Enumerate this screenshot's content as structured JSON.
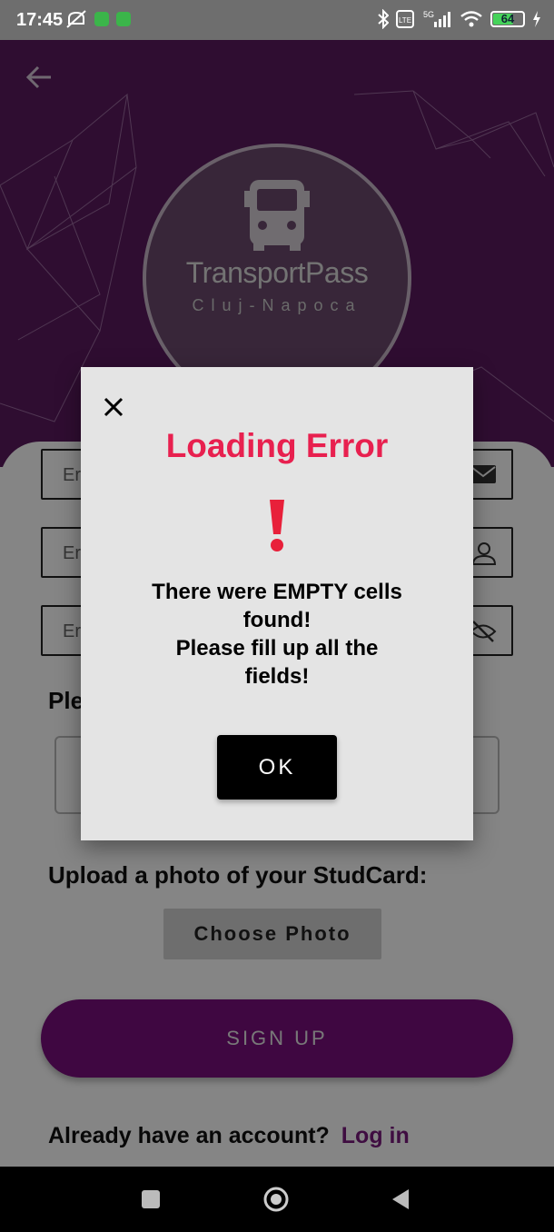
{
  "status_bar": {
    "time": "17:45",
    "battery_level": "64",
    "icons": [
      "mute-icon",
      "app-icon",
      "app-icon",
      "bluetooth-icon",
      "volte-icon",
      "5g-signal-icon",
      "wifi-icon",
      "battery-icon",
      "charging-icon"
    ]
  },
  "header": {
    "back_icon": "arrow-left-icon",
    "logo_title": "TransportPass",
    "logo_subtitle": "Cluj-Napoca"
  },
  "form": {
    "fields": [
      {
        "placeholder": "Er",
        "icon": "email-icon"
      },
      {
        "placeholder": "Er",
        "icon": "person-icon"
      },
      {
        "placeholder": "Er",
        "icon": "eye-off-icon"
      }
    ],
    "select_label": "Ple",
    "upload_label": "Upload a photo of your StudCard:",
    "choose_photo": "Choose Photo",
    "signup": "SIGN UP",
    "login_prompt": "Already have an account?",
    "login_link": "Log in"
  },
  "dialog": {
    "title": "Loading Error",
    "icon": "exclamation-icon",
    "message_line1": "There were EMPTY cells\nfound!",
    "message_line2": "Please fill up all the\nfields!",
    "ok": "OK",
    "close_icon": "close-icon",
    "title_color": "#e8204f"
  },
  "nav_bar": {
    "buttons": [
      "recents-icon",
      "home-icon",
      "back-icon"
    ]
  },
  "colors": {
    "brand": "#7a0f7e",
    "hero": "#5a1a5f"
  }
}
